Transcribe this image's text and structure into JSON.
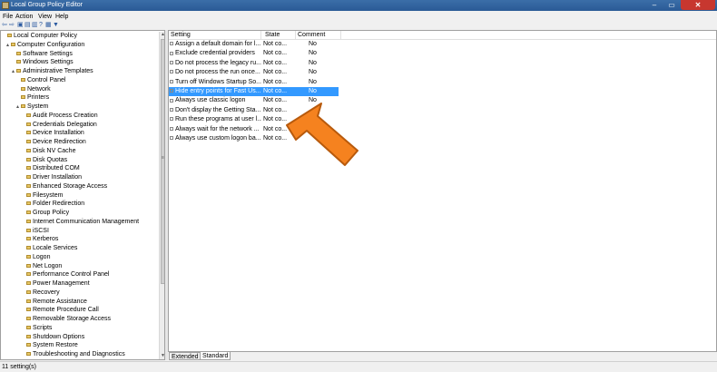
{
  "window": {
    "title": "Local Group Policy Editor",
    "min": "–",
    "max": "▭",
    "close": "✕"
  },
  "menu": [
    "File",
    "Action",
    "View",
    "Help"
  ],
  "toolbar": [
    "⇦",
    "⇨",
    "▣",
    "▤",
    "▥",
    "?",
    "▦",
    "▼"
  ],
  "tree": [
    {
      "label": "Local Computer Policy",
      "expander": "",
      "level": 0
    },
    {
      "label": "Computer Configuration",
      "expander": "▴",
      "level": 1
    },
    {
      "label": "Software Settings",
      "expander": "",
      "level": 2
    },
    {
      "label": "Windows Settings",
      "expander": "",
      "level": 2
    },
    {
      "label": "Administrative Templates",
      "expander": "▴",
      "level": 2
    },
    {
      "label": "Control Panel",
      "expander": "",
      "level": 3
    },
    {
      "label": "Network",
      "expander": "",
      "level": 3
    },
    {
      "label": "Printers",
      "expander": "",
      "level": 3
    },
    {
      "label": "System",
      "expander": "▴",
      "level": 3
    },
    {
      "label": "Audit Process Creation",
      "expander": "",
      "level": 4
    },
    {
      "label": "Credentials Delegation",
      "expander": "",
      "level": 4
    },
    {
      "label": "Device Installation",
      "expander": "",
      "level": 4
    },
    {
      "label": "Device Redirection",
      "expander": "",
      "level": 4
    },
    {
      "label": "Disk NV Cache",
      "expander": "",
      "level": 4
    },
    {
      "label": "Disk Quotas",
      "expander": "",
      "level": 4
    },
    {
      "label": "Distributed COM",
      "expander": "",
      "level": 4
    },
    {
      "label": "Driver Installation",
      "expander": "",
      "level": 4
    },
    {
      "label": "Enhanced Storage Access",
      "expander": "",
      "level": 4
    },
    {
      "label": "Filesystem",
      "expander": "",
      "level": 4
    },
    {
      "label": "Folder Redirection",
      "expander": "",
      "level": 4
    },
    {
      "label": "Group Policy",
      "expander": "",
      "level": 4
    },
    {
      "label": "Internet Communication Management",
      "expander": "",
      "level": 4
    },
    {
      "label": "iSCSI",
      "expander": "",
      "level": 4
    },
    {
      "label": "Kerberos",
      "expander": "",
      "level": 4
    },
    {
      "label": "Locale Services",
      "expander": "",
      "level": 4
    },
    {
      "label": "Logon",
      "expander": "",
      "level": 4
    },
    {
      "label": "Net Logon",
      "expander": "",
      "level": 4
    },
    {
      "label": "Performance Control Panel",
      "expander": "",
      "level": 4
    },
    {
      "label": "Power Management",
      "expander": "",
      "level": 4
    },
    {
      "label": "Recovery",
      "expander": "",
      "level": 4
    },
    {
      "label": "Remote Assistance",
      "expander": "",
      "level": 4
    },
    {
      "label": "Remote Procedure Call",
      "expander": "",
      "level": 4
    },
    {
      "label": "Removable Storage Access",
      "expander": "",
      "level": 4
    },
    {
      "label": "Scripts",
      "expander": "",
      "level": 4
    },
    {
      "label": "Shutdown Options",
      "expander": "",
      "level": 4
    },
    {
      "label": "System Restore",
      "expander": "",
      "level": 4
    },
    {
      "label": "Troubleshooting and Diagnostics",
      "expander": "",
      "level": 4
    }
  ],
  "scroll": {
    "up": "▲",
    "mid": "≡",
    "down": "▼"
  },
  "list": {
    "headers": {
      "setting": "Setting",
      "state": "State",
      "comment": "Comment"
    },
    "rows": [
      {
        "setting": "Assign a default domain for l...",
        "state": "Not co...",
        "comment": "No",
        "selected": false
      },
      {
        "setting": "Exclude credential providers",
        "state": "Not co...",
        "comment": "No",
        "selected": false
      },
      {
        "setting": "Do not process the legacy ru...",
        "state": "Not co...",
        "comment": "No",
        "selected": false
      },
      {
        "setting": "Do not process the run once...",
        "state": "Not co...",
        "comment": "No",
        "selected": false
      },
      {
        "setting": "Turn off Windows Startup So...",
        "state": "Not co...",
        "comment": "No",
        "selected": false
      },
      {
        "setting": "Hide entry points for Fast Us...",
        "state": "Not co...",
        "comment": "No",
        "selected": true
      },
      {
        "setting": "Always use classic logon",
        "state": "Not co...",
        "comment": "No",
        "selected": false
      },
      {
        "setting": "Don't display the Getting Sta...",
        "state": "Not co...",
        "comment": "",
        "selected": false
      },
      {
        "setting": "Run these programs at user l...",
        "state": "Not co...",
        "comment": "",
        "selected": false
      },
      {
        "setting": "Always wait for the network ...",
        "state": "Not co...",
        "comment": "",
        "selected": false
      },
      {
        "setting": "Always use custom logon ba...",
        "state": "Not co...",
        "comment": "",
        "selected": false
      }
    ]
  },
  "tabs": [
    {
      "label": "Extended",
      "active": false
    },
    {
      "label": "Standard",
      "active": true
    }
  ],
  "status": "11 setting(s)",
  "colors": {
    "selection": "#3399ff",
    "title": "#2a5a96",
    "close": "#c7372f",
    "arrow": "#f5821f"
  }
}
